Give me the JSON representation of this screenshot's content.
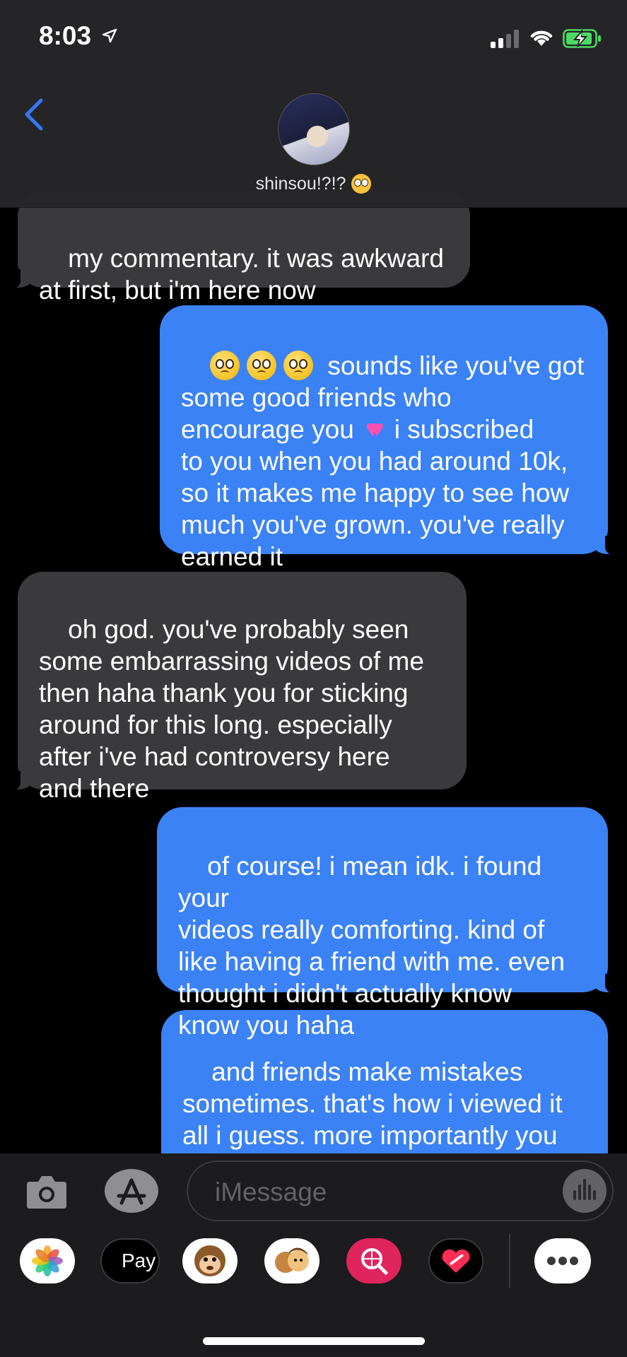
{
  "status_bar": {
    "time": "8:03"
  },
  "header": {
    "contact_name": "shinsou!?!?",
    "back_label": "<"
  },
  "messages": [
    {
      "side": "received",
      "text": "my commentary. it was awkward\nat first, but i'm here now"
    },
    {
      "side": "sent",
      "text": " sounds like you've got\nsome good friends who\nencourage you ",
      "text_2": " i subscribed\nto you when you had around 10k,\nso it makes me happy to see how\nmuch you've grown. you've really\nearned it"
    },
    {
      "side": "received",
      "text": "oh god. you've probably seen\nsome embarrassing videos of me\nthen haha thank you for sticking\naround for this long. especially\nafter i've had controversy here\nand there"
    },
    {
      "side": "sent",
      "text": "of course! i mean idk. i found your\nvideos really comforting. kind of\nlike having a friend with me. even\nthought i didn't actually know\nknow you haha"
    },
    {
      "side": "sent",
      "text": "and friends make mistakes\nsometimes. that's how i viewed it\nall i guess. more importantly you\nown up to your mistakes which"
    }
  ],
  "input": {
    "placeholder": "iMessage"
  },
  "app_drawer": {
    "pay_label": "Pay",
    "pay_logo_glyph": ""
  },
  "icons": [
    "location-arrow-icon",
    "signal-icon",
    "wifi-icon",
    "battery-charging-icon",
    "back-chevron-icon",
    "camera-icon",
    "app-store-icon",
    "audio-waveform-icon",
    "photos-app-icon",
    "apple-pay-icon",
    "animoji-icon",
    "memoji-icon",
    "web-search-icon",
    "digital-touch-icon",
    "more-icon"
  ],
  "colors": {
    "sent_bubble": "#3b82f6",
    "received_bubble": "#3a3a3c",
    "accent": "#3478f6"
  }
}
